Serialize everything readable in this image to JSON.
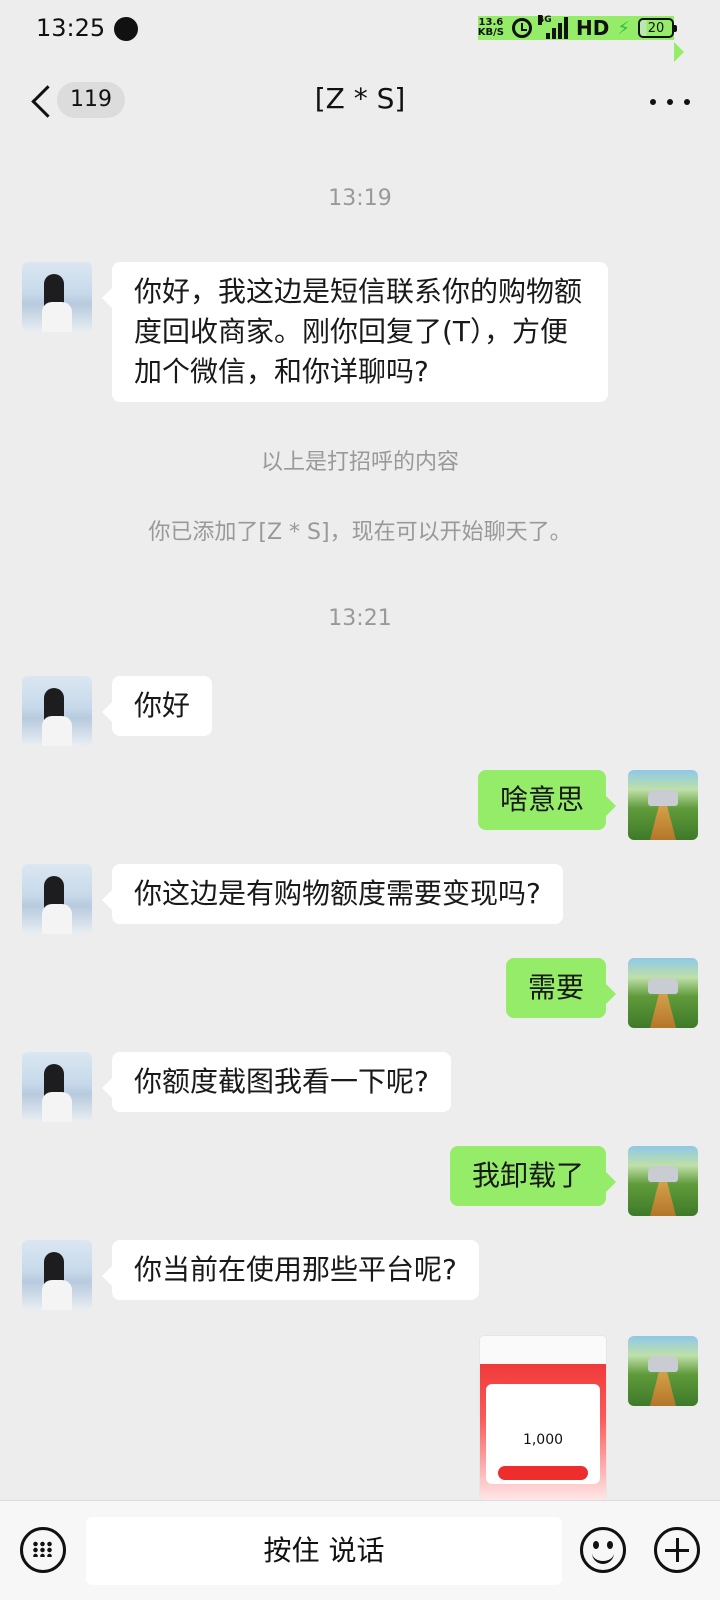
{
  "status_bar": {
    "time": "13:25",
    "net_speed_top": "13.6",
    "net_speed_bottom": "KB/S",
    "network": "4G",
    "hd": "HD",
    "battery": "20"
  },
  "header": {
    "unread_count": "119",
    "title": "[Z * S]"
  },
  "chat": {
    "time_1": "13:19",
    "msg_1": "你好，我这边是短信联系你的购物额度回收商家。刚你回复了(T），方便加个微信，和你详聊吗?",
    "sys_greeting": "以上是打招呼的内容",
    "sys_added": "你已添加了[Z * S]，现在可以开始聊天了。",
    "time_2": "13:21",
    "msg_2": "你好",
    "msg_3": "啥意思",
    "msg_4": "你这边是有购物额度需要变现吗?",
    "msg_5": "需要",
    "msg_6": "你额度截图我看一下呢?",
    "msg_7": "我卸载了",
    "msg_8": "你当前在使用那些平台呢?",
    "image_msg_amount": "1,000"
  },
  "input_bar": {
    "hold_to_talk": "按住 说话"
  },
  "colors": {
    "background": "#EDEDED",
    "sent_bubble": "#95EC69",
    "received_bubble": "#FFFFFF"
  }
}
